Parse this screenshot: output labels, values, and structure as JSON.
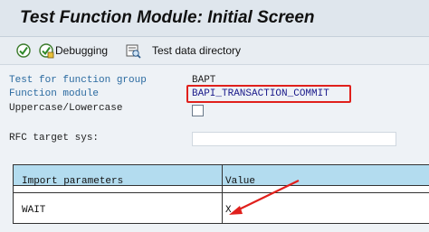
{
  "window": {
    "title": "Test Function Module: Initial Screen"
  },
  "toolbar": {
    "execute_icon": "execute-icon",
    "debug_icon": "debug-execute-icon",
    "debugging_label": "Debugging",
    "testdata_icon": "test-data-directory-icon",
    "test_data_directory_label": "Test data directory"
  },
  "form": {
    "function_group_label": "Test for function group",
    "function_group_value": "BAPT",
    "function_module_label": "Function module",
    "function_module_value": "BAPI_TRANSACTION_COMMIT",
    "uppercase_label": "Uppercase/Lowercase",
    "uppercase_checked": false,
    "rfc_target_label": "RFC target sys:",
    "rfc_target_value": ""
  },
  "params_table": {
    "headers": [
      "Import parameters",
      "Value"
    ],
    "rows": [
      {
        "param": "WAIT",
        "value": "X"
      }
    ]
  },
  "colors": {
    "highlight": "#e0201c",
    "table_header": "#b3dcef",
    "label_blue": "#2a6aa0"
  }
}
